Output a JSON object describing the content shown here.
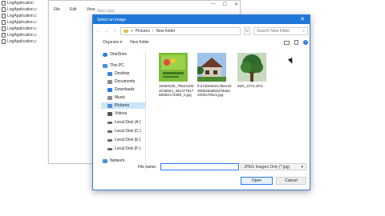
{
  "background": {
    "tree_items": [
      "LogApplication",
      "LogApplication.c",
      "LogApplication.c",
      "LogApplication.c",
      "LogApplication.c",
      "LogApplication.c",
      "LogApplication.c"
    ],
    "menu": [
      "File",
      "Edit",
      "View"
    ],
    "new_user_text": "New User"
  },
  "dialog": {
    "title": "Select an image",
    "address": {
      "root": "Pictures",
      "folder": "New folder"
    },
    "search_placeholder": "Search New folder",
    "toolbar": {
      "organize": "Organize ▾",
      "new_folder": "New folder"
    },
    "sidebar": [
      {
        "label": "OneDrive",
        "icon": "cloud-icon",
        "color": "#2a7be4"
      },
      {
        "label": "This PC",
        "icon": "computer-icon",
        "color": "#4a90d9"
      },
      {
        "label": "Desktop",
        "icon": "desktop-icon",
        "color": "#3b86d4"
      },
      {
        "label": "Documents",
        "icon": "documents-icon",
        "color": "#8a8a8a"
      },
      {
        "label": "Downloads",
        "icon": "download-icon",
        "color": "#2a7be4"
      },
      {
        "label": "Music",
        "icon": "music-icon",
        "color": "#8a8a8a"
      },
      {
        "label": "Pictures",
        "icon": "pictures-icon",
        "color": "#4a90d9"
      },
      {
        "label": "Videos",
        "icon": "video-icon",
        "color": "#555555"
      },
      {
        "label": "Local Disk (A:)",
        "icon": "disk-icon",
        "color": "#666666"
      },
      {
        "label": "Local Disk (C:)",
        "icon": "disk-icon",
        "color": "#666666"
      },
      {
        "label": "Local Disk (E:)",
        "icon": "disk-icon",
        "color": "#666666"
      },
      {
        "label": "Local Disk (F:)",
        "icon": "disk-icon",
        "color": "#666666"
      },
      {
        "label": "Network",
        "icon": "network-icon",
        "color": "#4a90d9"
      }
    ],
    "files": [
      {
        "name": "10959109_796241003108924_36137791768082173289_n.jpg"
      },
      {
        "name": "fc274be502ccf5ee420668253db3d79a92.1000x750x1.jpg"
      },
      {
        "name": "IMG_2772.JPG"
      }
    ],
    "file_name_label": "File name:",
    "file_name_value": "",
    "file_type": "JPEG Images Only (*.jpg)",
    "open_label": "Open",
    "cancel_label": "Cancel"
  },
  "colors": {
    "accent": "#1e78d7",
    "selection": "#cce4f7"
  }
}
